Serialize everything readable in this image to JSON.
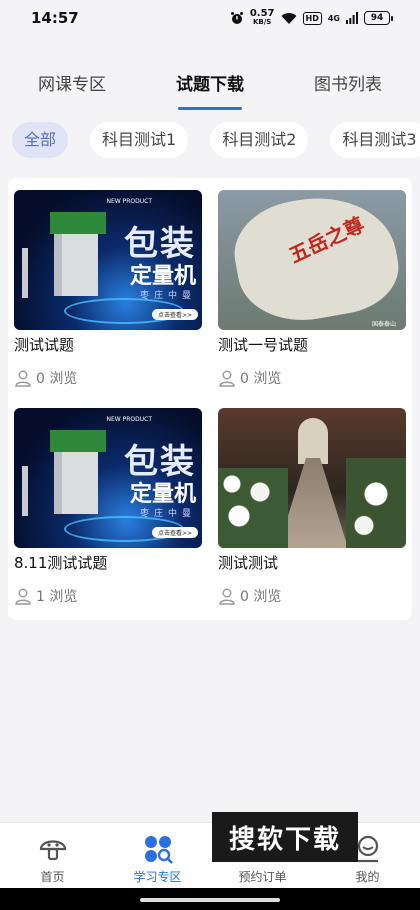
{
  "status_bar": {
    "time": "14:57",
    "net_speed": "0.57",
    "net_unit": "KB/S",
    "hd": "HD",
    "signal": "4G",
    "battery": "94"
  },
  "top_tabs": [
    {
      "label": "网课专区",
      "active": false
    },
    {
      "label": "试题下载",
      "active": true
    },
    {
      "label": "图书列表",
      "active": false
    }
  ],
  "filter_chips": [
    {
      "label": "全部",
      "active": true
    },
    {
      "label": "科目测试1",
      "active": false
    },
    {
      "label": "科目测试2",
      "active": false
    },
    {
      "label": "科目测试3",
      "active": false
    }
  ],
  "cards": [
    {
      "title": "测试试题",
      "views": "0 浏览",
      "image": "packaging-machine-ad",
      "image_text": {
        "big": "包装",
        "sub": "定量机",
        "city": "枣庄中曼",
        "tag": "NEW PRODUCT",
        "btn": "点击查看>>"
      }
    },
    {
      "title": "测试一号试题",
      "views": "0 浏览",
      "image": "inscribed-rock",
      "image_text": {
        "big": "五岳之尊",
        "caption": "国泰泰山 "
      }
    },
    {
      "title": "8.11测试试题",
      "views": "1 浏览",
      "image": "packaging-machine-ad",
      "image_text": {
        "big": "包装",
        "sub": "定量机",
        "city": "枣庄中曼",
        "tag": "NEW PRODUCT",
        "btn": "点击查看>>"
      }
    },
    {
      "title": "测试测试",
      "views": "0 浏览",
      "image": "wedding-aisle-flowers",
      "image_text": {}
    }
  ],
  "bottom_nav": [
    {
      "label": "首页",
      "icon": "home-mushroom-icon",
      "active": false
    },
    {
      "label": "学习专区",
      "icon": "study-dots-icon",
      "active": true
    },
    {
      "label": "预约订单",
      "icon": "order-icon",
      "active": false
    },
    {
      "label": "我的",
      "icon": "profile-icon",
      "active": false
    }
  ],
  "watermark": "搜软下载",
  "colors": {
    "accent": "#2b6fe0",
    "chip_active_bg": "#dfe4f7",
    "page_bg": "#f4f4f6"
  }
}
